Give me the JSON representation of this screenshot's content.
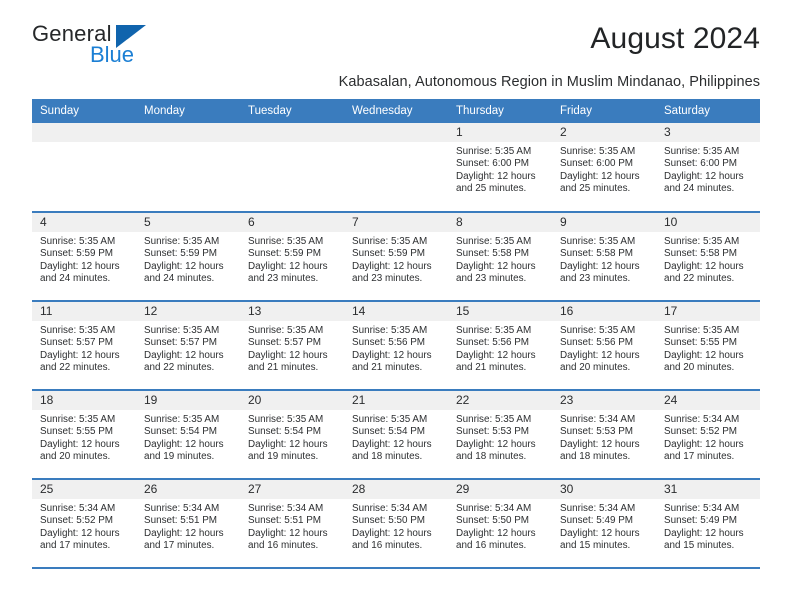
{
  "branding": {
    "logo_primary": "General",
    "logo_secondary": "Blue"
  },
  "header": {
    "title": "August 2024",
    "subtitle": "Kabasalan, Autonomous Region in Muslim Mindanao, Philippines"
  },
  "calendar": {
    "weekday_headers": [
      "Sunday",
      "Monday",
      "Tuesday",
      "Wednesday",
      "Thursday",
      "Friday",
      "Saturday"
    ],
    "colors": {
      "header_band": "#3a7cbe",
      "daynum_band": "#f0f0f0",
      "accent_blue": "#1b7fd4",
      "logo_triangle": "#1064ad",
      "text": "#2d2f31"
    },
    "weeks": [
      [
        {
          "day": "",
          "lines": []
        },
        {
          "day": "",
          "lines": []
        },
        {
          "day": "",
          "lines": []
        },
        {
          "day": "",
          "lines": []
        },
        {
          "day": "1",
          "lines": [
            "Sunrise: 5:35 AM",
            "Sunset: 6:00 PM",
            "Daylight: 12 hours",
            "and 25 minutes."
          ]
        },
        {
          "day": "2",
          "lines": [
            "Sunrise: 5:35 AM",
            "Sunset: 6:00 PM",
            "Daylight: 12 hours",
            "and 25 minutes."
          ]
        },
        {
          "day": "3",
          "lines": [
            "Sunrise: 5:35 AM",
            "Sunset: 6:00 PM",
            "Daylight: 12 hours",
            "and 24 minutes."
          ]
        }
      ],
      [
        {
          "day": "4",
          "lines": [
            "Sunrise: 5:35 AM",
            "Sunset: 5:59 PM",
            "Daylight: 12 hours",
            "and 24 minutes."
          ]
        },
        {
          "day": "5",
          "lines": [
            "Sunrise: 5:35 AM",
            "Sunset: 5:59 PM",
            "Daylight: 12 hours",
            "and 24 minutes."
          ]
        },
        {
          "day": "6",
          "lines": [
            "Sunrise: 5:35 AM",
            "Sunset: 5:59 PM",
            "Daylight: 12 hours",
            "and 23 minutes."
          ]
        },
        {
          "day": "7",
          "lines": [
            "Sunrise: 5:35 AM",
            "Sunset: 5:59 PM",
            "Daylight: 12 hours",
            "and 23 minutes."
          ]
        },
        {
          "day": "8",
          "lines": [
            "Sunrise: 5:35 AM",
            "Sunset: 5:58 PM",
            "Daylight: 12 hours",
            "and 23 minutes."
          ]
        },
        {
          "day": "9",
          "lines": [
            "Sunrise: 5:35 AM",
            "Sunset: 5:58 PM",
            "Daylight: 12 hours",
            "and 23 minutes."
          ]
        },
        {
          "day": "10",
          "lines": [
            "Sunrise: 5:35 AM",
            "Sunset: 5:58 PM",
            "Daylight: 12 hours",
            "and 22 minutes."
          ]
        }
      ],
      [
        {
          "day": "11",
          "lines": [
            "Sunrise: 5:35 AM",
            "Sunset: 5:57 PM",
            "Daylight: 12 hours",
            "and 22 minutes."
          ]
        },
        {
          "day": "12",
          "lines": [
            "Sunrise: 5:35 AM",
            "Sunset: 5:57 PM",
            "Daylight: 12 hours",
            "and 22 minutes."
          ]
        },
        {
          "day": "13",
          "lines": [
            "Sunrise: 5:35 AM",
            "Sunset: 5:57 PM",
            "Daylight: 12 hours",
            "and 21 minutes."
          ]
        },
        {
          "day": "14",
          "lines": [
            "Sunrise: 5:35 AM",
            "Sunset: 5:56 PM",
            "Daylight: 12 hours",
            "and 21 minutes."
          ]
        },
        {
          "day": "15",
          "lines": [
            "Sunrise: 5:35 AM",
            "Sunset: 5:56 PM",
            "Daylight: 12 hours",
            "and 21 minutes."
          ]
        },
        {
          "day": "16",
          "lines": [
            "Sunrise: 5:35 AM",
            "Sunset: 5:56 PM",
            "Daylight: 12 hours",
            "and 20 minutes."
          ]
        },
        {
          "day": "17",
          "lines": [
            "Sunrise: 5:35 AM",
            "Sunset: 5:55 PM",
            "Daylight: 12 hours",
            "and 20 minutes."
          ]
        }
      ],
      [
        {
          "day": "18",
          "lines": [
            "Sunrise: 5:35 AM",
            "Sunset: 5:55 PM",
            "Daylight: 12 hours",
            "and 20 minutes."
          ]
        },
        {
          "day": "19",
          "lines": [
            "Sunrise: 5:35 AM",
            "Sunset: 5:54 PM",
            "Daylight: 12 hours",
            "and 19 minutes."
          ]
        },
        {
          "day": "20",
          "lines": [
            "Sunrise: 5:35 AM",
            "Sunset: 5:54 PM",
            "Daylight: 12 hours",
            "and 19 minutes."
          ]
        },
        {
          "day": "21",
          "lines": [
            "Sunrise: 5:35 AM",
            "Sunset: 5:54 PM",
            "Daylight: 12 hours",
            "and 18 minutes."
          ]
        },
        {
          "day": "22",
          "lines": [
            "Sunrise: 5:35 AM",
            "Sunset: 5:53 PM",
            "Daylight: 12 hours",
            "and 18 minutes."
          ]
        },
        {
          "day": "23",
          "lines": [
            "Sunrise: 5:34 AM",
            "Sunset: 5:53 PM",
            "Daylight: 12 hours",
            "and 18 minutes."
          ]
        },
        {
          "day": "24",
          "lines": [
            "Sunrise: 5:34 AM",
            "Sunset: 5:52 PM",
            "Daylight: 12 hours",
            "and 17 minutes."
          ]
        }
      ],
      [
        {
          "day": "25",
          "lines": [
            "Sunrise: 5:34 AM",
            "Sunset: 5:52 PM",
            "Daylight: 12 hours",
            "and 17 minutes."
          ]
        },
        {
          "day": "26",
          "lines": [
            "Sunrise: 5:34 AM",
            "Sunset: 5:51 PM",
            "Daylight: 12 hours",
            "and 17 minutes."
          ]
        },
        {
          "day": "27",
          "lines": [
            "Sunrise: 5:34 AM",
            "Sunset: 5:51 PM",
            "Daylight: 12 hours",
            "and 16 minutes."
          ]
        },
        {
          "day": "28",
          "lines": [
            "Sunrise: 5:34 AM",
            "Sunset: 5:50 PM",
            "Daylight: 12 hours",
            "and 16 minutes."
          ]
        },
        {
          "day": "29",
          "lines": [
            "Sunrise: 5:34 AM",
            "Sunset: 5:50 PM",
            "Daylight: 12 hours",
            "and 16 minutes."
          ]
        },
        {
          "day": "30",
          "lines": [
            "Sunrise: 5:34 AM",
            "Sunset: 5:49 PM",
            "Daylight: 12 hours",
            "and 15 minutes."
          ]
        },
        {
          "day": "31",
          "lines": [
            "Sunrise: 5:34 AM",
            "Sunset: 5:49 PM",
            "Daylight: 12 hours",
            "and 15 minutes."
          ]
        }
      ]
    ]
  }
}
